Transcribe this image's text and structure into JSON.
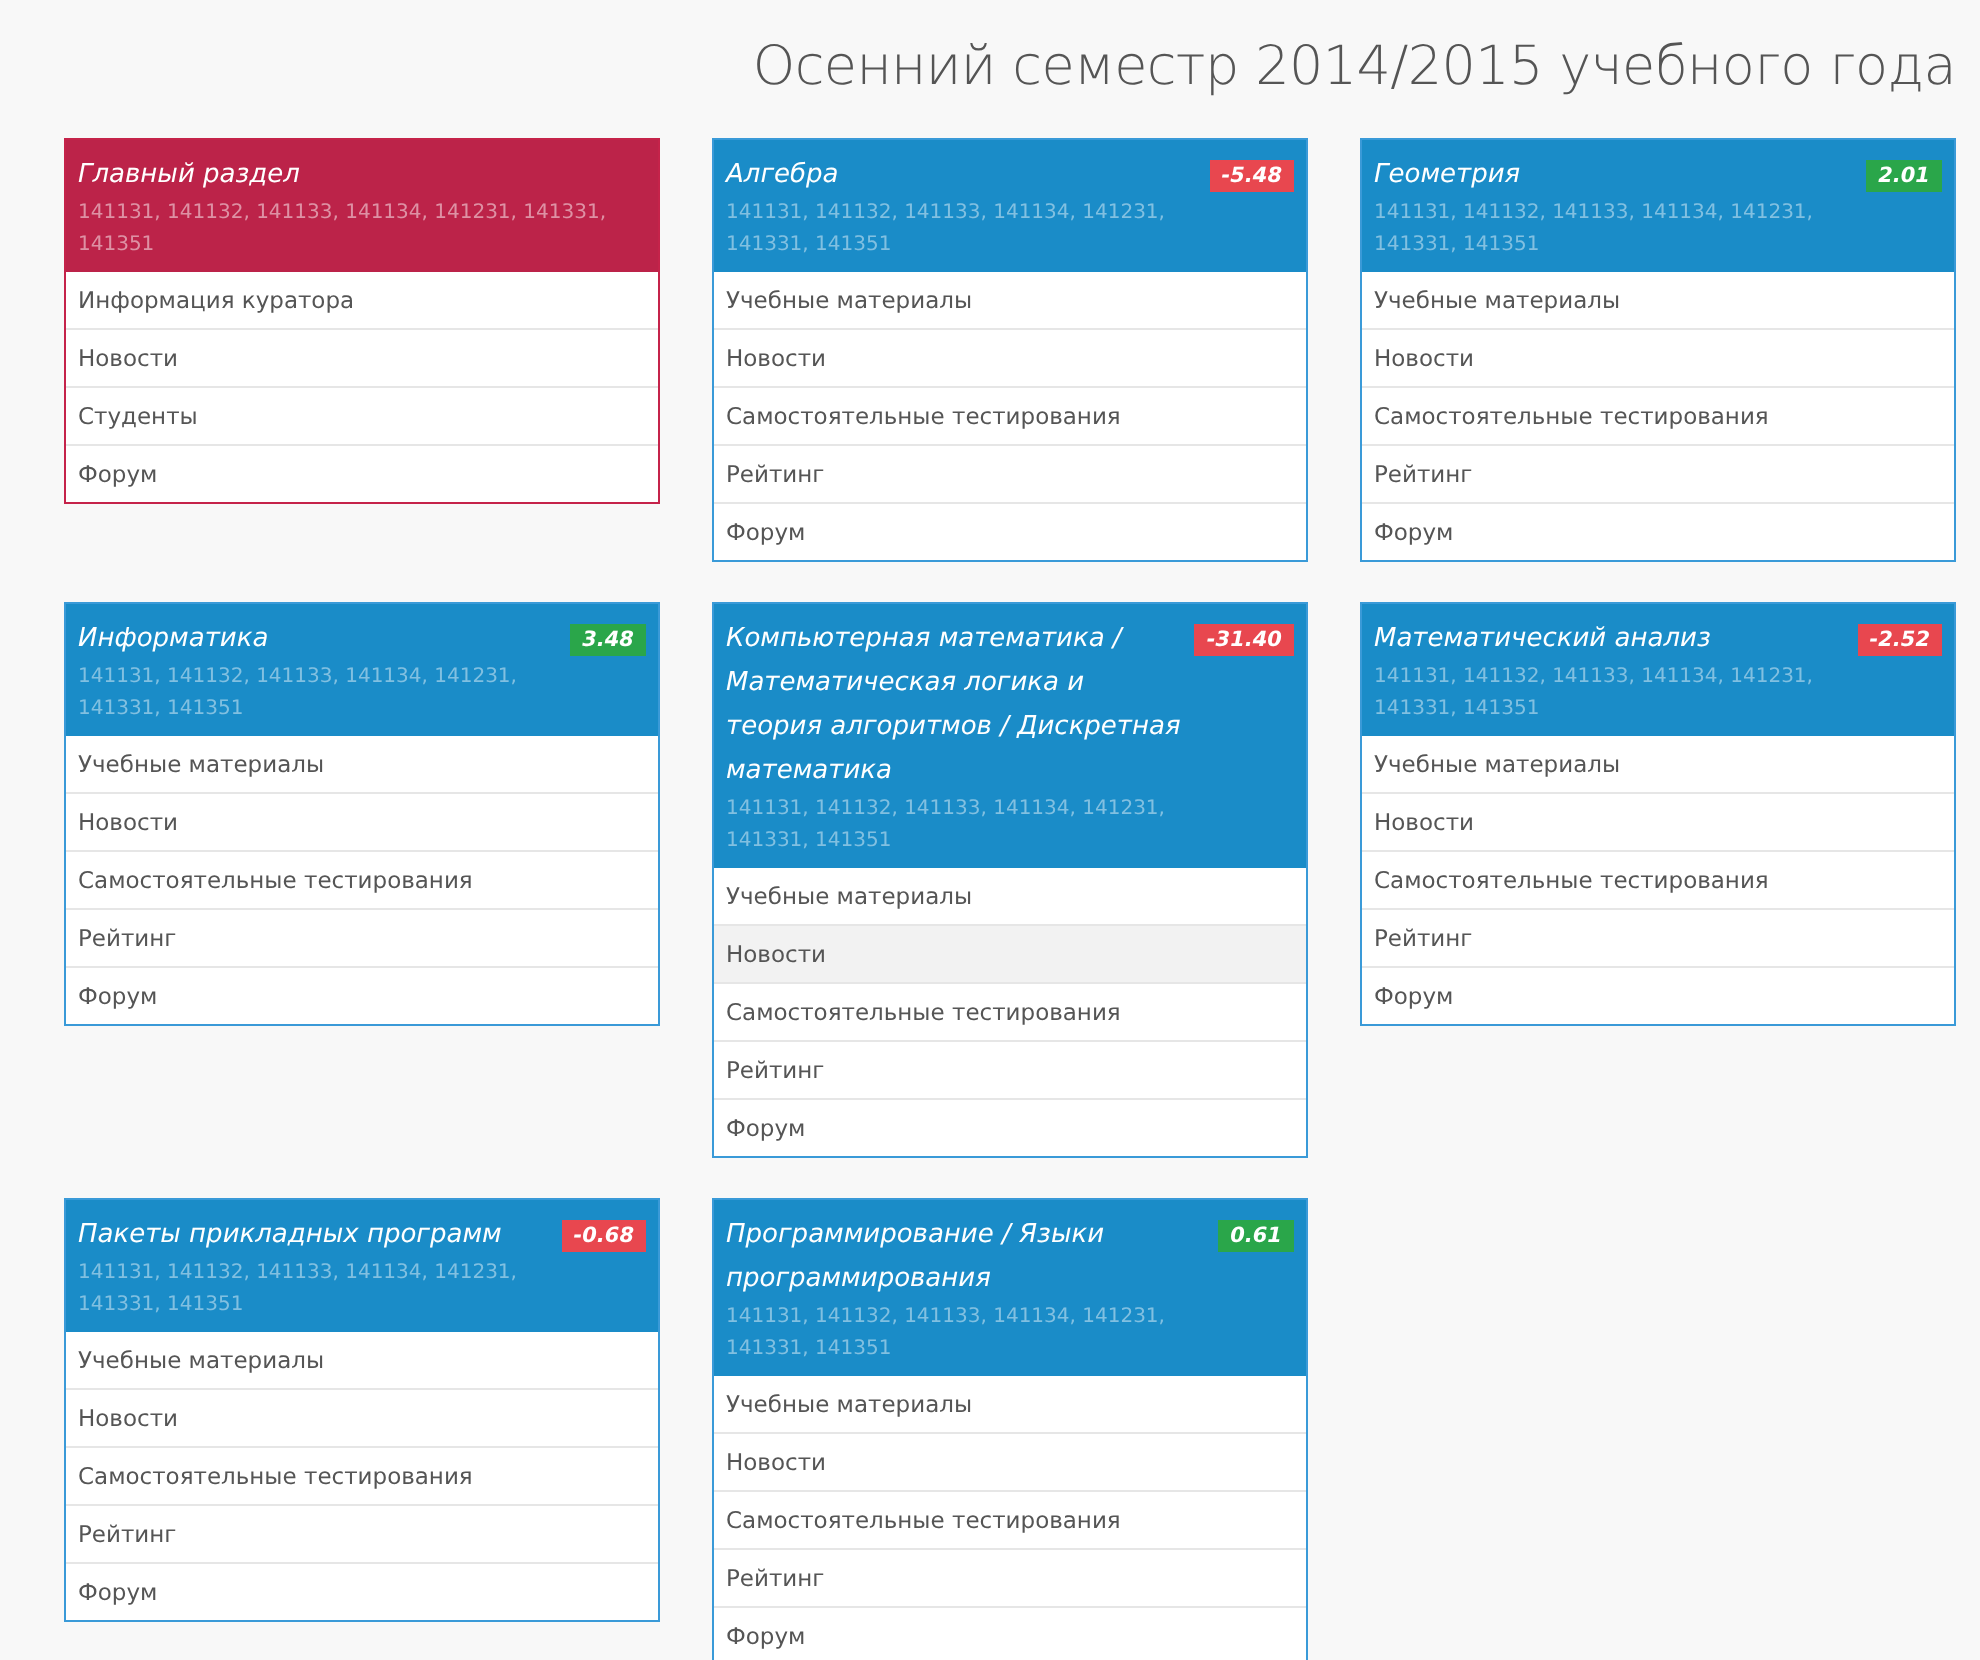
{
  "page_title": "Осенний семестр 2014/2015 учебного года",
  "cards": [
    {
      "kind": "main",
      "title": "Главный раздел",
      "groups": "141131, 141132, 141133, 141134, 141231, 141331, 141351",
      "items": [
        {
          "label": "Информация куратора",
          "selected": false
        },
        {
          "label": "Новости",
          "selected": false
        },
        {
          "label": "Студенты",
          "selected": false
        },
        {
          "label": "Форум",
          "selected": false
        }
      ]
    },
    {
      "kind": "subject",
      "title": "Алгебра",
      "badge": {
        "text": "-5.48",
        "kind": "negative"
      },
      "groups": "141131, 141132, 141133, 141134, 141231, 141331, 141351",
      "items": [
        {
          "label": "Учебные материалы",
          "selected": false
        },
        {
          "label": "Новости",
          "selected": false
        },
        {
          "label": "Самостоятельные тестирования",
          "selected": false
        },
        {
          "label": "Рейтинг",
          "selected": false
        },
        {
          "label": "Форум",
          "selected": false
        }
      ]
    },
    {
      "kind": "subject",
      "title": "Геометрия",
      "badge": {
        "text": "2.01",
        "kind": "positive"
      },
      "groups": "141131, 141132, 141133, 141134, 141231, 141331, 141351",
      "items": [
        {
          "label": "Учебные материалы",
          "selected": false
        },
        {
          "label": "Новости",
          "selected": false
        },
        {
          "label": "Самостоятельные тестирования",
          "selected": false
        },
        {
          "label": "Рейтинг",
          "selected": false
        },
        {
          "label": "Форум",
          "selected": false
        }
      ]
    },
    {
      "kind": "subject",
      "title": "Информатика",
      "badge": {
        "text": "3.48",
        "kind": "positive"
      },
      "groups": "141131, 141132, 141133, 141134, 141231, 141331, 141351",
      "items": [
        {
          "label": "Учебные материалы",
          "selected": false
        },
        {
          "label": "Новости",
          "selected": false
        },
        {
          "label": "Самостоятельные тестирования",
          "selected": false
        },
        {
          "label": "Рейтинг",
          "selected": false
        },
        {
          "label": "Форум",
          "selected": false
        }
      ]
    },
    {
      "kind": "subject",
      "title": "Компьютерная математика / Математическая логика и теория алгоритмов / Дискретная математика",
      "badge": {
        "text": "-31.40",
        "kind": "negative"
      },
      "groups": "141131, 141132, 141133, 141134, 141231, 141331, 141351",
      "items": [
        {
          "label": "Учебные материалы",
          "selected": false
        },
        {
          "label": "Новости",
          "selected": true
        },
        {
          "label": "Самостоятельные тестирования",
          "selected": false
        },
        {
          "label": "Рейтинг",
          "selected": false
        },
        {
          "label": "Форум",
          "selected": false
        }
      ]
    },
    {
      "kind": "subject",
      "title": "Математический анализ",
      "badge": {
        "text": "-2.52",
        "kind": "negative"
      },
      "groups": "141131, 141132, 141133, 141134, 141231, 141331, 141351",
      "items": [
        {
          "label": "Учебные материалы",
          "selected": false
        },
        {
          "label": "Новости",
          "selected": false
        },
        {
          "label": "Самостоятельные тестирования",
          "selected": false
        },
        {
          "label": "Рейтинг",
          "selected": false
        },
        {
          "label": "Форум",
          "selected": false
        }
      ]
    },
    {
      "kind": "subject",
      "title": "Пакеты прикладных программ",
      "badge": {
        "text": "-0.68",
        "kind": "negative"
      },
      "groups": "141131, 141132, 141133, 141134, 141231, 141331, 141351",
      "items": [
        {
          "label": "Учебные материалы",
          "selected": false
        },
        {
          "label": "Новости",
          "selected": false
        },
        {
          "label": "Самостоятельные тестирования",
          "selected": false
        },
        {
          "label": "Рейтинг",
          "selected": false
        },
        {
          "label": "Форум",
          "selected": false
        }
      ]
    },
    {
      "kind": "subject",
      "title": "Программирование / Языки программирования",
      "badge": {
        "text": "0.61",
        "kind": "positive"
      },
      "groups": "141131, 141132, 141133, 141134, 141231, 141331, 141351",
      "items": [
        {
          "label": "Учебные материалы",
          "selected": false
        },
        {
          "label": "Новости",
          "selected": false
        },
        {
          "label": "Самостоятельные тестирования",
          "selected": false
        },
        {
          "label": "Рейтинг",
          "selected": false
        },
        {
          "label": "Форум",
          "selected": false
        }
      ]
    }
  ]
}
